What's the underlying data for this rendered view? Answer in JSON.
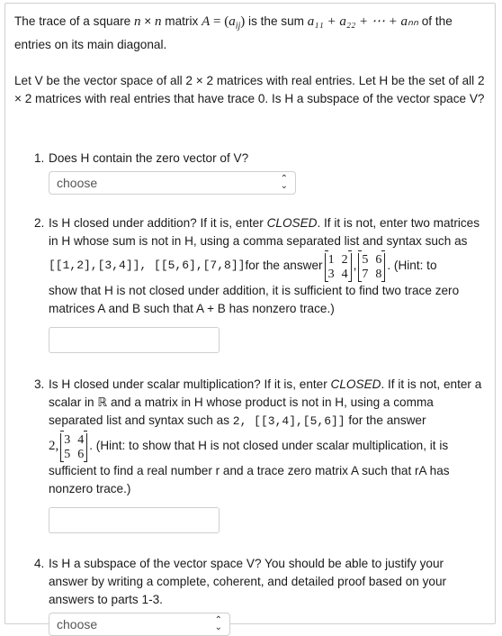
{
  "intro": {
    "p1_a": "The trace of a square ",
    "p1_n1": "n",
    "p1_x": " × ",
    "p1_n2": "n",
    "p1_b": " matrix ",
    "p1_A": "A",
    "p1_eq": " = (",
    "p1_aij": "a",
    "p1_ij": "ij",
    "p1_c": ") is the sum ",
    "p1_sum": "a₁₁ + a₂₂ + ⋯ + aₙₙ",
    "p1_d": " of the entries on its main diagonal.",
    "p2": "Let V be the vector space of all 2 × 2 matrices with real entries. Let H be the set of all 2 × 2 matrices with real entries that have trace 0. Is H a subspace of the vector space V?"
  },
  "q1": {
    "num": "1.",
    "text": "Does H contain the zero vector of V?",
    "select_value": "choose"
  },
  "q2": {
    "num": "2.",
    "text_a": "Is H closed under addition? If it is, enter ",
    "closed": "CLOSED",
    "text_b": ". If it is not, enter two matrices in H whose sum is not in H, using a comma separated list and syntax such as",
    "code": "[[1,2],[3,4]], [[5,6],[7,8]]",
    "for_answer": " for the answer",
    "m1": [
      "1",
      "2",
      "3",
      "4"
    ],
    "m2": [
      "5",
      "6",
      "7",
      "8"
    ],
    "hint_a": ". (Hint: to",
    "hint_b": "show that H is not closed under addition, it is sufficient to find two trace zero matrices A and B such that A + B has nonzero trace.)"
  },
  "q3": {
    "num": "3.",
    "text_a": "Is H closed under scalar multiplication? If it is, enter ",
    "closed": "CLOSED",
    "text_b": ". If it is not, enter a scalar in ℝ and a matrix in H whose product is not in H, using a comma separated list and syntax such as ",
    "code": "2, [[3,4],[5,6]]",
    "for_answer": " for the answer",
    "scalar": "2,",
    "m": [
      "3",
      "4",
      "5",
      "6"
    ],
    "hint_a": ". (Hint: to show that H is not closed under scalar multiplication, it is",
    "hint_b": "sufficient to find a real number r and a trace zero matrix A such that rA has nonzero trace.)"
  },
  "q4": {
    "num": "4.",
    "text": "Is H a subspace of the vector space V? You should be able to justify your answer by writing a complete, coherent, and detailed proof based on your answers to parts 1-3.",
    "select_value": "choose"
  }
}
